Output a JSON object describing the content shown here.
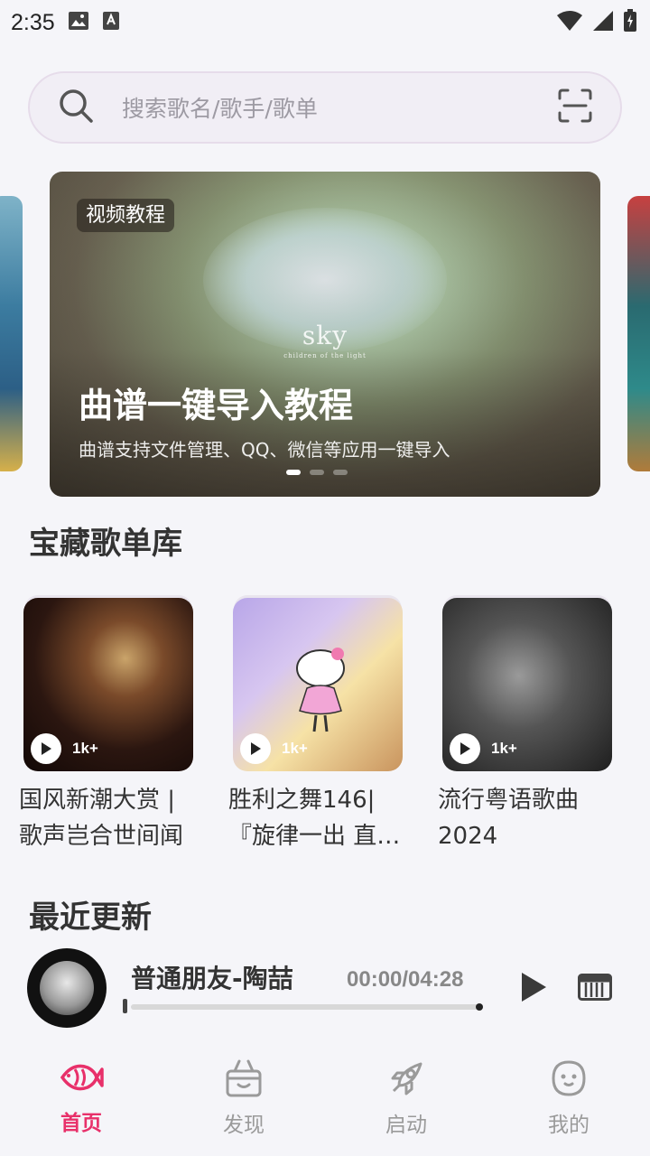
{
  "status_bar": {
    "time": "2:35"
  },
  "search": {
    "placeholder": "搜索歌名/歌手/歌单"
  },
  "banner": {
    "tag": "视频教程",
    "title": "曲谱一键导入教程",
    "subtitle": "曲谱支持文件管理、QQ、微信等应用一键导入",
    "logo_text": "sky",
    "logo_subtext": "children of the light"
  },
  "sections": {
    "playlists_title": "宝藏歌单库",
    "recent_title": "最近更新"
  },
  "playlists": [
    {
      "name": "国风新潮大赏 | 歌声岂合世间闻",
      "plays": "1k+"
    },
    {
      "name": "胜利之舞146|『旋律一出 直…",
      "plays": "1k+"
    },
    {
      "name": "流行粤语歌曲2024",
      "plays": "1k+"
    }
  ],
  "recent": {
    "song_title": "普通朋友-陶喆",
    "time": "00:00/04:28",
    "progress": 0
  },
  "nav": [
    {
      "label": "首页",
      "icon": "fish-icon",
      "active": true
    },
    {
      "label": "发现",
      "icon": "basket-icon",
      "active": false
    },
    {
      "label": "启动",
      "icon": "rocket-icon",
      "active": false
    },
    {
      "label": "我的",
      "icon": "face-icon",
      "active": false
    }
  ],
  "colors": {
    "accent": "#e8306a",
    "background": "#f5f5f9"
  }
}
